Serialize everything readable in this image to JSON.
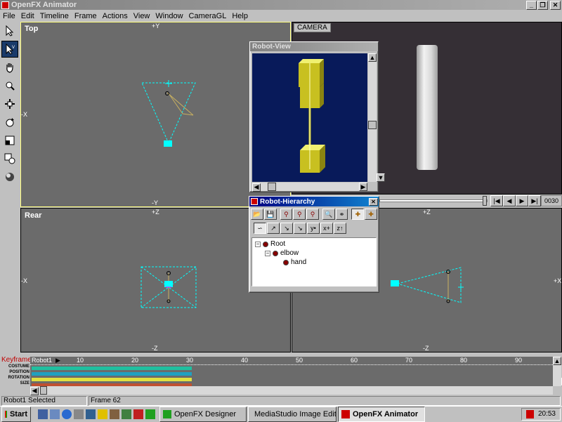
{
  "window": {
    "title": "OpenFX Animator"
  },
  "menu": [
    "File",
    "Edit",
    "Timeline",
    "Frame",
    "Actions",
    "View",
    "Window",
    "CameraGL",
    "Help"
  ],
  "viewports": {
    "top": {
      "label": "Top",
      "axis_top": "+Y",
      "axis_bottom": "-Y",
      "axis_left": "-X"
    },
    "camera": {
      "label": "CAMERA",
      "frame_counter": "0030"
    },
    "rear": {
      "label": "Rear",
      "axis_top": "+Z",
      "axis_bottom": "-Z",
      "axis_left": "-X"
    },
    "side": {
      "axis_top": "+Z",
      "axis_bottom": "-Z",
      "axis_right": "+X"
    }
  },
  "robot_view": {
    "title": "Robot-View"
  },
  "robot_hierarchy": {
    "title": "Robot-Hierarchy",
    "tree": [
      {
        "label": "Root",
        "level": 0
      },
      {
        "label": "elbow",
        "level": 1
      },
      {
        "label": "hand",
        "level": 2
      }
    ],
    "buttons_row2": [
      "y•",
      "x+",
      "z↑"
    ]
  },
  "timeline": {
    "keyframer_label": "Keyframer",
    "track_name": "Robot1",
    "tracks": [
      "COSTUME",
      "POSITION",
      "ROTATION",
      "SIZE"
    ],
    "ruler": [
      "10",
      "20",
      "30",
      "40",
      "50",
      "60",
      "70",
      "80",
      "90"
    ]
  },
  "status": {
    "left": "Robot1 Selected",
    "right": "Frame 62"
  },
  "taskbar": {
    "start_label": "Start",
    "tasks": [
      "OpenFX Designer",
      "MediaStudio Image Editor",
      "OpenFX Animator"
    ],
    "clock": "20:53"
  },
  "colors": {
    "viewport_bg": "#6b6b6b",
    "robot_view_bg": "#081a5a",
    "active_title": "#000080",
    "selection": "#00ffff"
  }
}
